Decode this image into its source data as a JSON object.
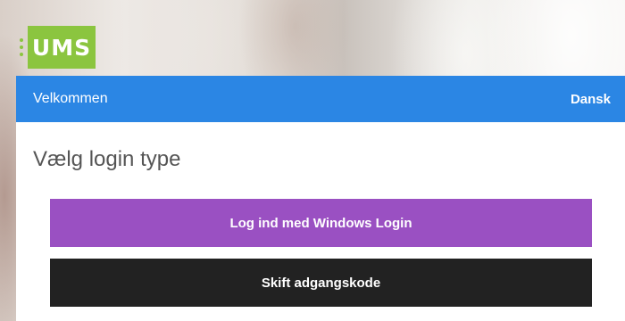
{
  "logo": {
    "text": "UMS",
    "color": "#8bc53f"
  },
  "header": {
    "title": "Velkommen",
    "language": "Dansk",
    "color": "#2b86e4"
  },
  "main": {
    "heading": "Vælg login type",
    "buttons": {
      "windows_login": {
        "label": "Log ind med Windows Login",
        "color": "#9a50c2"
      },
      "change_password": {
        "label": "Skift adgangskode",
        "color": "#222222"
      }
    }
  }
}
